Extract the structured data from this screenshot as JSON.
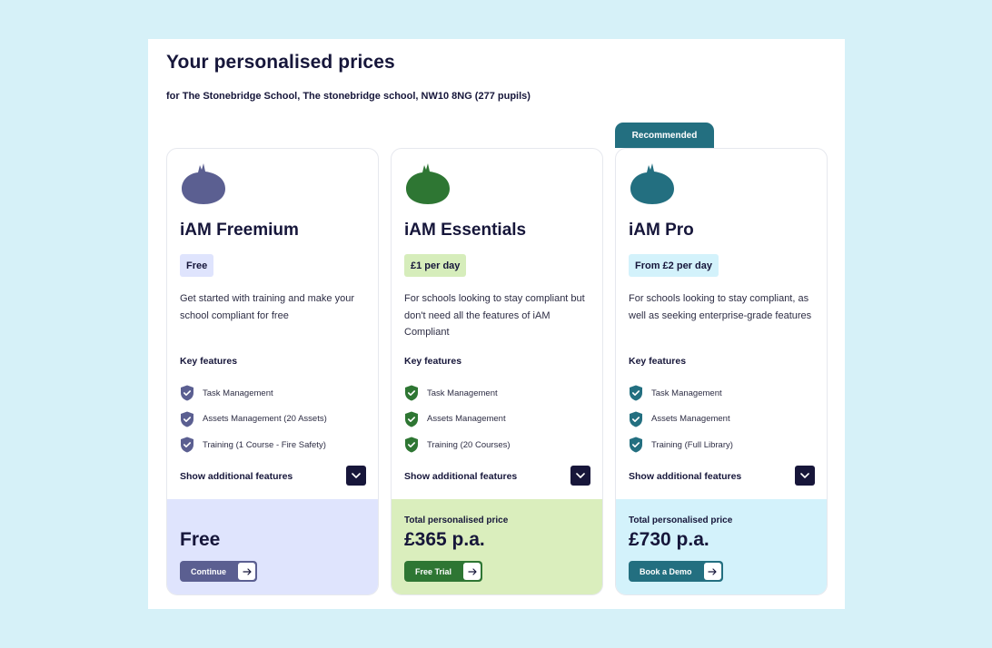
{
  "header": {
    "title": "Your personalised prices",
    "subtitle": "for The Stonebridge School, The stonebridge school, NW10 8NG (277 pupils)"
  },
  "colors": {
    "freemium_accent": "#5b5f91",
    "essentials_accent": "#2e7633",
    "pro_accent": "#236f80",
    "dark_navy": "#16163a",
    "page_background": "#d6f1f8"
  },
  "plans": [
    {
      "name": "iAM Freemium",
      "logo_icon": "onion-logo-icon",
      "badge": "Free",
      "description": "Get started with training and make your school compliant for free",
      "key_features_title": "Key features",
      "features": [
        "Task Management",
        "Assets Management (20 Assets)",
        "Training (1 Course - Fire Safety)"
      ],
      "feature_icon": "shield-check-icon",
      "show_more_label": "Show additional features",
      "total_label": "",
      "total_price": "Free",
      "cta_label": "Continue",
      "cta_icon": "arrow-right-icon"
    },
    {
      "name": "iAM Essentials",
      "logo_icon": "onion-logo-icon",
      "badge": "£1 per day",
      "description": "For schools looking to stay compliant but don't need all the features of iAM Compliant",
      "key_features_title": "Key features",
      "features": [
        "Task Management",
        "Assets Management",
        "Training (20 Courses)"
      ],
      "feature_icon": "shield-check-icon",
      "show_more_label": "Show additional features",
      "total_label": "Total personalised price",
      "total_price": "£365 p.a.",
      "cta_label": "Free Trial",
      "cta_icon": "arrow-right-icon"
    },
    {
      "name": "iAM Pro",
      "logo_icon": "onion-logo-icon",
      "recommended_label": "Recommended",
      "badge": "From £2 per day",
      "description": "For schools looking to stay compliant, as well as seeking enterprise-grade features",
      "key_features_title": "Key features",
      "features": [
        "Task Management",
        "Assets Management",
        "Training (Full Library)"
      ],
      "feature_icon": "shield-check-icon",
      "show_more_label": "Show additional features",
      "total_label": "Total personalised price",
      "total_price": "£730 p.a.",
      "cta_label": "Book a Demo",
      "cta_icon": "arrow-right-icon"
    }
  ]
}
